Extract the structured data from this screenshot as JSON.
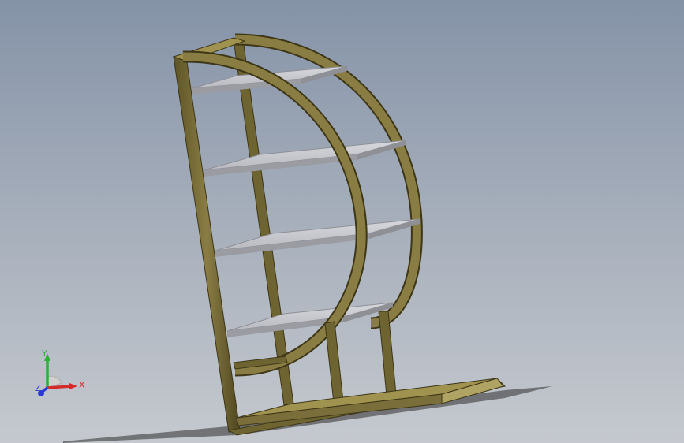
{
  "viewport": {
    "background_top": "#8593a8",
    "background_bottom": "#c5c9cf"
  },
  "model": {
    "frame_color": "#7a6e3a",
    "frame_highlight": "#b0a464",
    "frame_shadow": "#4a421e",
    "shelf_color": "#c9cbd0",
    "shelf_edge": "#8e9096",
    "shadow_color": "#3a3a3a"
  },
  "triad": {
    "x_label": "X",
    "y_label": "Y",
    "z_label": "Z",
    "x_color": "#d42a2a",
    "y_color": "#2fae3a",
    "z_color": "#2a3ad4"
  }
}
